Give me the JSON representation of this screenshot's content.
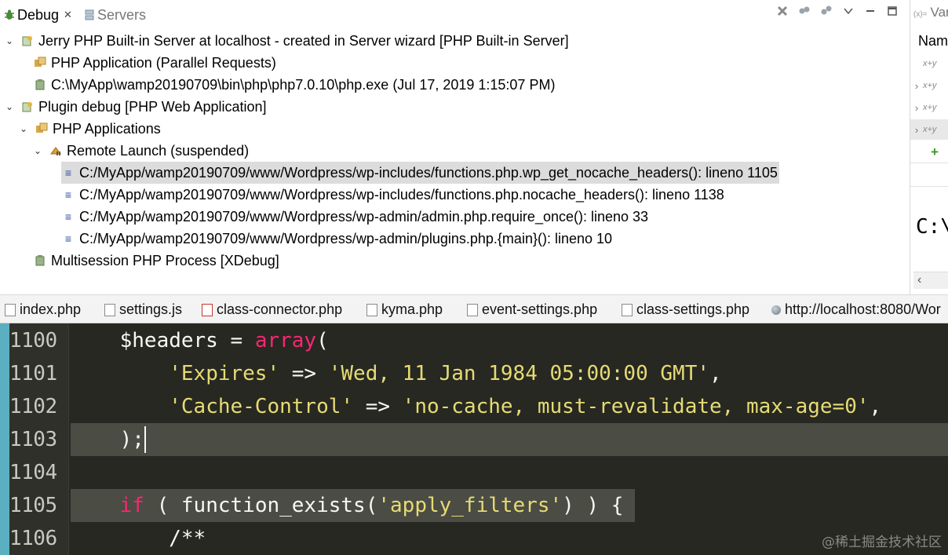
{
  "debug_view": {
    "tabs": [
      {
        "label": "Debug",
        "close": "✕"
      },
      {
        "label": "Servers"
      }
    ],
    "toolbar_icons": [
      "remove-all-terminated-icon",
      "connect-icon",
      "disconnect-icon",
      "view-menu-icon",
      "minimize-icon",
      "maximize-icon"
    ],
    "tree": [
      {
        "label": "Jerry PHP Built-in Server at localhost - created in Server wizard [PHP Built-in Server]",
        "icon": "launch-config-icon",
        "expanded": true
      },
      {
        "label": "PHP Application (Parallel Requests)",
        "icon": "php-application-icon"
      },
      {
        "label": "C:\\MyApp\\wamp20190709\\bin\\php\\php7.0.10\\php.exe (Jul 17, 2019 1:15:07 PM)",
        "icon": "process-icon"
      },
      {
        "label": "Plugin debug [PHP Web Application]",
        "icon": "launch-config-icon",
        "expanded": true
      },
      {
        "label": "PHP Applications",
        "icon": "php-application-icon",
        "expanded": true
      },
      {
        "label": "Remote Launch (suspended)",
        "icon": "thread-suspended-icon",
        "expanded": true
      },
      {
        "label": "C:/MyApp/wamp20190709/www/Wordpress/wp-includes/functions.php.wp_get_nocache_headers(): lineno 1105",
        "icon": "stack-frame-icon",
        "selected": true
      },
      {
        "label": "C:/MyApp/wamp20190709/www/Wordpress/wp-includes/functions.php.nocache_headers(): lineno 1138",
        "icon": "stack-frame-icon"
      },
      {
        "label": "C:/MyApp/wamp20190709/www/Wordpress/wp-admin/admin.php.require_once(): lineno 33",
        "icon": "stack-frame-icon"
      },
      {
        "label": "C:/MyApp/wamp20190709/www/Wordpress/wp-admin/plugins.php.{main}(): lineno 10",
        "icon": "stack-frame-icon"
      },
      {
        "label": "Multisession PHP Process [XDebug]",
        "icon": "process-icon"
      }
    ]
  },
  "variables_view": {
    "tab_icon_text": "(x)=",
    "tab_label": "Var",
    "column_header": "Nam",
    "row_icon_text": "x+y",
    "detail_text": "C:\\"
  },
  "editor_tabs": [
    {
      "label": "index.php",
      "icon": "php-file-icon"
    },
    {
      "label": "settings.js",
      "icon": "js-file-icon"
    },
    {
      "label": "class-connector.php",
      "icon": "php-file-error-icon"
    },
    {
      "label": "kyma.php",
      "icon": "php-file-icon"
    },
    {
      "label": "event-settings.php",
      "icon": "php-file-icon"
    },
    {
      "label": "class-settings.php",
      "icon": "php-file-icon"
    },
    {
      "label": "http://localhost:8080/Wor",
      "icon": "globe-icon"
    }
  ],
  "code": {
    "line_numbers": [
      "1100",
      "1101",
      "1102",
      "1103",
      "1104",
      "1105",
      "1106"
    ],
    "lines": [
      [
        {
          "t": "    $headers = ",
          "c": "var"
        },
        {
          "t": "array",
          "c": "kw"
        },
        {
          "t": "(",
          "c": "var"
        }
      ],
      [
        {
          "t": "        ",
          "c": "var"
        },
        {
          "t": "'Expires'",
          "c": "str"
        },
        {
          "t": " => ",
          "c": "var"
        },
        {
          "t": "'Wed, 11 Jan 1984 05:00:00 GMT'",
          "c": "str"
        },
        {
          "t": ",",
          "c": "var"
        }
      ],
      [
        {
          "t": "        ",
          "c": "var"
        },
        {
          "t": "'Cache-Control'",
          "c": "str"
        },
        {
          "t": " => ",
          "c": "var"
        },
        {
          "t": "'no-cache, must-revalidate, max-age=0'",
          "c": "str"
        },
        {
          "t": ",",
          "c": "var"
        }
      ],
      [
        {
          "t": "    );",
          "c": "var"
        }
      ],
      [
        {
          "t": "",
          "c": "var"
        }
      ],
      [
        {
          "t": "    ",
          "c": "var"
        },
        {
          "t": "if",
          "c": "kw"
        },
        {
          "t": " ( function_exists(",
          "c": "var"
        },
        {
          "t": "'apply_filters'",
          "c": "str"
        },
        {
          "t": ") ) {",
          "c": "var"
        }
      ],
      [
        {
          "t": "        /**",
          "c": "cm"
        }
      ]
    ],
    "colors": {
      "background": "#272822",
      "keyword": "#f92672",
      "string": "#e6db74",
      "text": "#f8f8f2",
      "current_line": "#4b4c44"
    }
  },
  "watermark": "@稀土掘金技术社区"
}
